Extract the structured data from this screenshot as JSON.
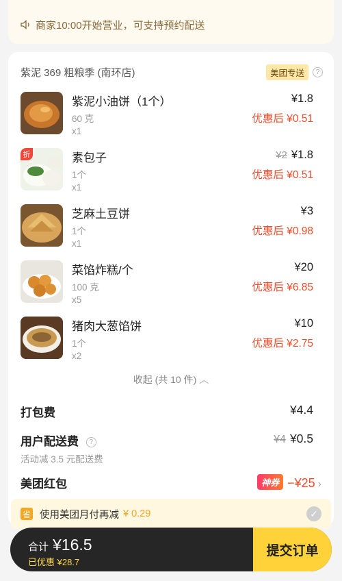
{
  "notice": {
    "icon": "speaker-icon",
    "text": "商家10:00开始营业，可支持预约配送"
  },
  "shop": {
    "name": "紫泥 369 粗粮季 (南环店)",
    "badge": "美团专送",
    "help": "?"
  },
  "items": [
    {
      "name": "紫泥小油饼（1个）",
      "spec": "60 克",
      "qty": "x1",
      "orig_price": "",
      "price": "¥1.8",
      "after": "优惠后 ¥0.51",
      "tag": "",
      "image": "fried-cake"
    },
    {
      "name": "素包子",
      "spec": "1个",
      "qty": "x1",
      "orig_price": "¥2",
      "price": "¥1.8",
      "after": "优惠后 ¥0.51",
      "tag": "折",
      "image": "steamed-bun"
    },
    {
      "name": "芝麻土豆饼",
      "spec": "1个",
      "qty": "x1",
      "orig_price": "",
      "price": "¥3",
      "after": "优惠后 ¥0.98",
      "tag": "",
      "image": "sesame-potato-pancake"
    },
    {
      "name": "菜馅炸糕/个",
      "spec": "100 克",
      "qty": "x5",
      "orig_price": "",
      "price": "¥20",
      "after": "优惠后 ¥6.85",
      "tag": "",
      "image": "fried-dumplings"
    },
    {
      "name": "猪肉大葱馅饼",
      "spec": "1个",
      "qty": "x2",
      "orig_price": "",
      "price": "¥10",
      "after": "优惠后 ¥2.75",
      "tag": "",
      "image": "meat-pie"
    }
  ],
  "collapse": {
    "label": "收起 (共 10 件)"
  },
  "packing_fee": {
    "label": "打包费",
    "value": "¥4.4"
  },
  "delivery_fee": {
    "label": "用户配送费",
    "orig": "¥4",
    "value": "¥0.5",
    "sub": "活动减 3.5 元配送费"
  },
  "red_packet": {
    "label": "美团红包",
    "badge": "神券",
    "value": "−¥25"
  },
  "monthly_pay": {
    "icon_text": "省",
    "text": "使用美团月付再减",
    "amount": "¥ 0.29"
  },
  "footer": {
    "total_label": "合计",
    "total_value": "¥16.5",
    "saved": "已优惠 ¥28.7",
    "submit_label": "提交订单"
  },
  "colors": {
    "accent_red": "#ef4b2b",
    "brand_yellow": "#ffd23a",
    "bar_dark": "#262626"
  }
}
